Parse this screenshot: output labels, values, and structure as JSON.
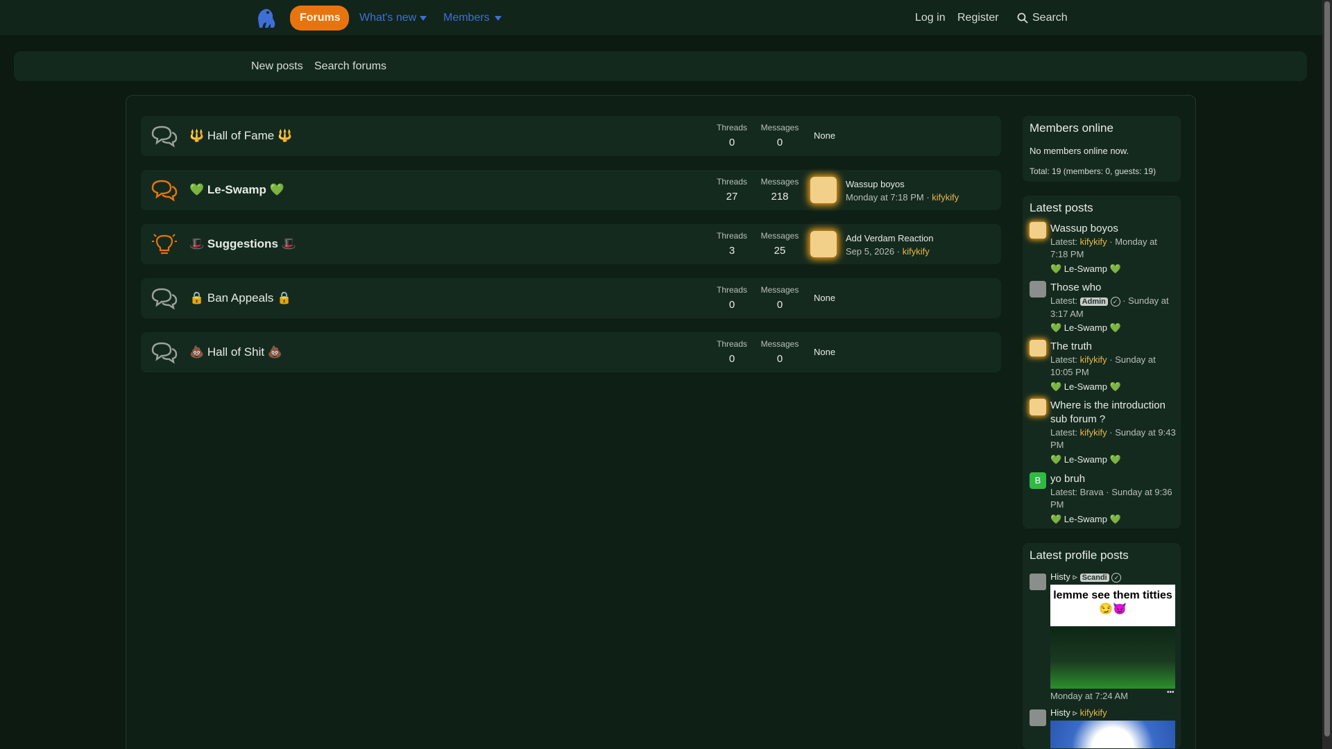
{
  "nav": {
    "tabs": [
      {
        "label": "Forums",
        "active": true
      },
      {
        "label": "What's new"
      },
      {
        "label": "Members"
      }
    ],
    "login": "Log in",
    "register": "Register",
    "search": "Search"
  },
  "subnav": {
    "new_posts": "New posts",
    "search_forums": "Search forums"
  },
  "forums": [
    {
      "title": "🔱 Hall of Fame 🔱",
      "threads_label": "Threads",
      "threads": "0",
      "messages_label": "Messages",
      "messages": "0",
      "last": "None",
      "icon": "chat-bubbles-icon"
    },
    {
      "title": "💚 Le-Swamp 💚",
      "threads_label": "Threads",
      "threads": "27",
      "messages_label": "Messages",
      "messages": "218",
      "last_title": "Wassup boyos",
      "last_time": "Monday at 7:18 PM",
      "last_sep": " · ",
      "last_user": "kifykify",
      "icon": "chat-bubbles-icon"
    },
    {
      "title": "🎩 Suggestions 🎩",
      "threads_label": "Threads",
      "threads": "3",
      "messages_label": "Messages",
      "messages": "25",
      "last_title": "Add Verdam Reaction",
      "last_time": "Sep 5, 2026",
      "last_sep": " · ",
      "last_user": "kifykify",
      "icon": "lightbulb-icon"
    },
    {
      "title": "🔒 Ban Appeals 🔒",
      "threads_label": "Threads",
      "threads": "0",
      "messages_label": "Messages",
      "messages": "0",
      "last": "None",
      "icon": "chat-bubbles-icon"
    },
    {
      "title": "💩 Hall of Shit 💩",
      "threads_label": "Threads",
      "threads": "0",
      "messages_label": "Messages",
      "messages": "0",
      "last": "None",
      "icon": "chat-bubbles-icon"
    }
  ],
  "sidebar": {
    "members_online": {
      "title": "Members online",
      "text": "No members online now.",
      "total": "Total: 19 (members: 0, guests: 19)"
    },
    "latest_posts": {
      "title": "Latest posts",
      "items": [
        {
          "title": "Wassup boyos",
          "latest": "Latest:",
          "user": "kifykify",
          "sep": " · ",
          "time_1": "Monday at",
          "time_2": "7:18 PM",
          "forum": "💚 Le-Swamp 💚",
          "avatar": "yellow"
        },
        {
          "title": "Those who",
          "latest": "Latest:",
          "user": "Admin",
          "sep": "",
          "time_1": "Sunday at",
          "time_2": "3:17 AM",
          "forum": "💚 Le-Swamp 💚",
          "avatar": "grey"
        },
        {
          "title": "The truth",
          "latest": "Latest:",
          "user": "kifykify",
          "sep": " · ",
          "time_1": "Sunday at",
          "time_2": "10:05 PM",
          "forum": "💚 Le-Swamp 💚",
          "avatar": "yellow"
        },
        {
          "title_1": "Where is the introduction",
          "title_2": "sub forum ?",
          "latest": "Latest:",
          "user": "kifykify",
          "sep": " · ",
          "time_1": "Sunday at 9:43",
          "time_2": "PM",
          "forum": "💚 Le-Swamp 💚",
          "avatar": "yellow"
        },
        {
          "title": "yo bruh",
          "latest": "Latest:",
          "user": "Brava",
          "sep": " · ",
          "time_1": "Sunday at 9:36",
          "time_2": "PM",
          "forum": "💚 Le-Swamp 💚",
          "avatar": "B"
        }
      ]
    },
    "latest_profile_posts": {
      "title": "Latest profile posts",
      "items": [
        {
          "from": "Histy",
          "to": "Scandi",
          "image_text": "lemme see them titties 😏😈",
          "time": "Monday at 7:24 AM",
          "more": "•••"
        },
        {
          "from": "Histy",
          "to": "kifykify"
        }
      ]
    }
  },
  "colors": {
    "accent": "#e8740f",
    "background": "#0c1a11",
    "link_gold": "#e7b64b",
    "nav_blue": "#3f6fd6"
  }
}
